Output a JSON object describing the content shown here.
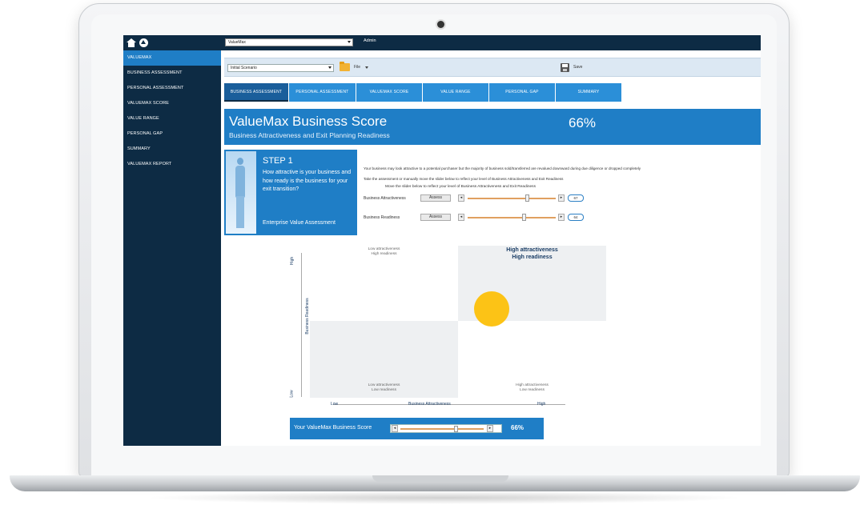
{
  "app": {
    "title": "ValueMax"
  },
  "sidebar": {
    "items": [
      {
        "label": "VALUEMAX",
        "active": true
      },
      {
        "label": "BUSINESS ASSESSMENT"
      },
      {
        "label": "PERSONAL ASSESSMENT"
      },
      {
        "label": "VALUEMAX SCORE"
      },
      {
        "label": "VALUE RANGE"
      },
      {
        "label": "PERSONAL GAP"
      },
      {
        "label": "SUMMARY"
      },
      {
        "label": "VALUEMAX REPORT"
      }
    ]
  },
  "topbar": {
    "select_value": "ValueMax",
    "admin_label": "Admin"
  },
  "toolbar": {
    "scenario_value": "Initial Scenario",
    "file_label": "File",
    "save_label": "Save"
  },
  "tabs": [
    {
      "label": "BUSINESS ASSESSMENT",
      "active": true
    },
    {
      "label": "PERSONAL ASSESSMENT"
    },
    {
      "label": "VALUEMAX SCORE"
    },
    {
      "label": "VALUE RANGE"
    },
    {
      "label": "PERSONAL GAP"
    },
    {
      "label": "SUMMARY"
    }
  ],
  "banner": {
    "title": "ValueMax Business Score",
    "subtitle": "Business Attractiveness and Exit Planning Readiness",
    "score": "66%"
  },
  "step": {
    "title": "STEP 1",
    "text": "How attractive is your business and how ready is the business for your exit transition?",
    "footer": "Enterprise Value Assessment"
  },
  "description": {
    "line1": "Your business may look attractive to a potential purchaser but the majority of business sold/transferred are revalued downward during due diligence or dropped completely",
    "line2": "Take the assessment or manually move the slider below to reflect your level of Business Attractiveness and Exit Readiness",
    "slider_heading": "Move the slider below to reflect your level of Business Attractiveness and Exit Readiness"
  },
  "sliders": [
    {
      "label": "Business Attractiveness",
      "button": "Assess",
      "value": 0.67,
      "display": "67"
    },
    {
      "label": "Business Readiness",
      "button": "Assess",
      "value": 0.64,
      "display": "64"
    }
  ],
  "quadrants": {
    "top_left": [
      "Low attractiveness",
      "High readiness"
    ],
    "top_right": [
      "High attractiveness",
      "High readiness"
    ],
    "bottom_left": [
      "Low attractiveness",
      "Low readiness"
    ],
    "bottom_right": [
      "High attractiveness",
      "Low readiness"
    ],
    "ylabel": "Business Readiness",
    "ylow": "Low",
    "yhigh": "High",
    "xlabel": "Business Attractiveness",
    "xlow": "Low",
    "xhigh": "High",
    "highlight_color": "#fcc316"
  },
  "scorebar": {
    "label": "Your ValueMax Business Score",
    "value": 0.66,
    "display": "66%"
  },
  "colors": {
    "primary": "#1f7ec6",
    "navy": "#0d2b44",
    "accent_track": "#e0a060"
  }
}
